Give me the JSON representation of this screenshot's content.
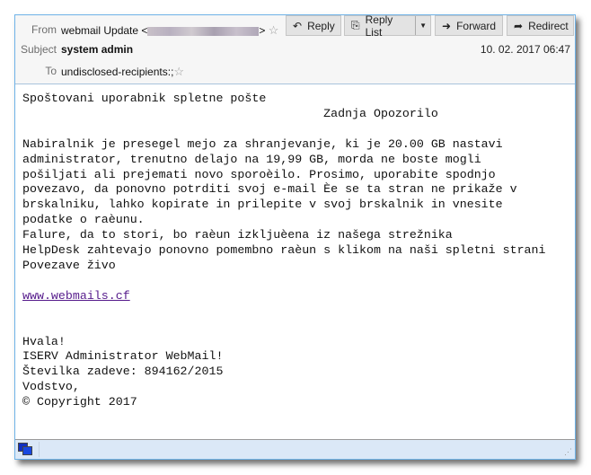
{
  "header": {
    "from_label": "From",
    "from_name": "webmail Update <",
    "from_end": ">",
    "subject_label": "Subject",
    "subject": "system admin",
    "to_label": "To",
    "to": "undisclosed-recipients:;",
    "date": "10. 02. 2017 06:47"
  },
  "toolbar": {
    "reply": "Reply",
    "reply_list": "Reply List",
    "forward": "Forward",
    "redirect": "Redirect"
  },
  "body": {
    "lines_top": "Spoštovani uporabnik spletne pošte\n                                          Zadnja Opozorilo\n\nNabiralnik je presegel mejo za shranjevanje, ki je 20.00 GB nastavi\nadministrator, trenutno delajo na 19,99 GB, morda ne boste mogli\npošiljati ali prejemati novo sporoèilo. Prosimo, uporabite spodnjo\npovezavo, da ponovno potrditi svoj e-mail Èe se ta stran ne prikaže v\nbrskalniku, lahko kopirate in prilepite v svoj brskalnik in vnesite\npodatke o raèunu.\nFalure, da to stori, bo raèun izkljuèena iz našega strežnika\nHelpDesk zahtevajo ponovno pomembno raèun s klikom na naši spletni strani\nPovezave živo\n\n",
    "link": "www.webmails.cf",
    "lines_bottom": "\n\n\nHvala!\nISERV Administrator WebMail!\nŠtevilka zadeve: 894162/2015\nVodstvo,\n© Copyright 2017"
  }
}
